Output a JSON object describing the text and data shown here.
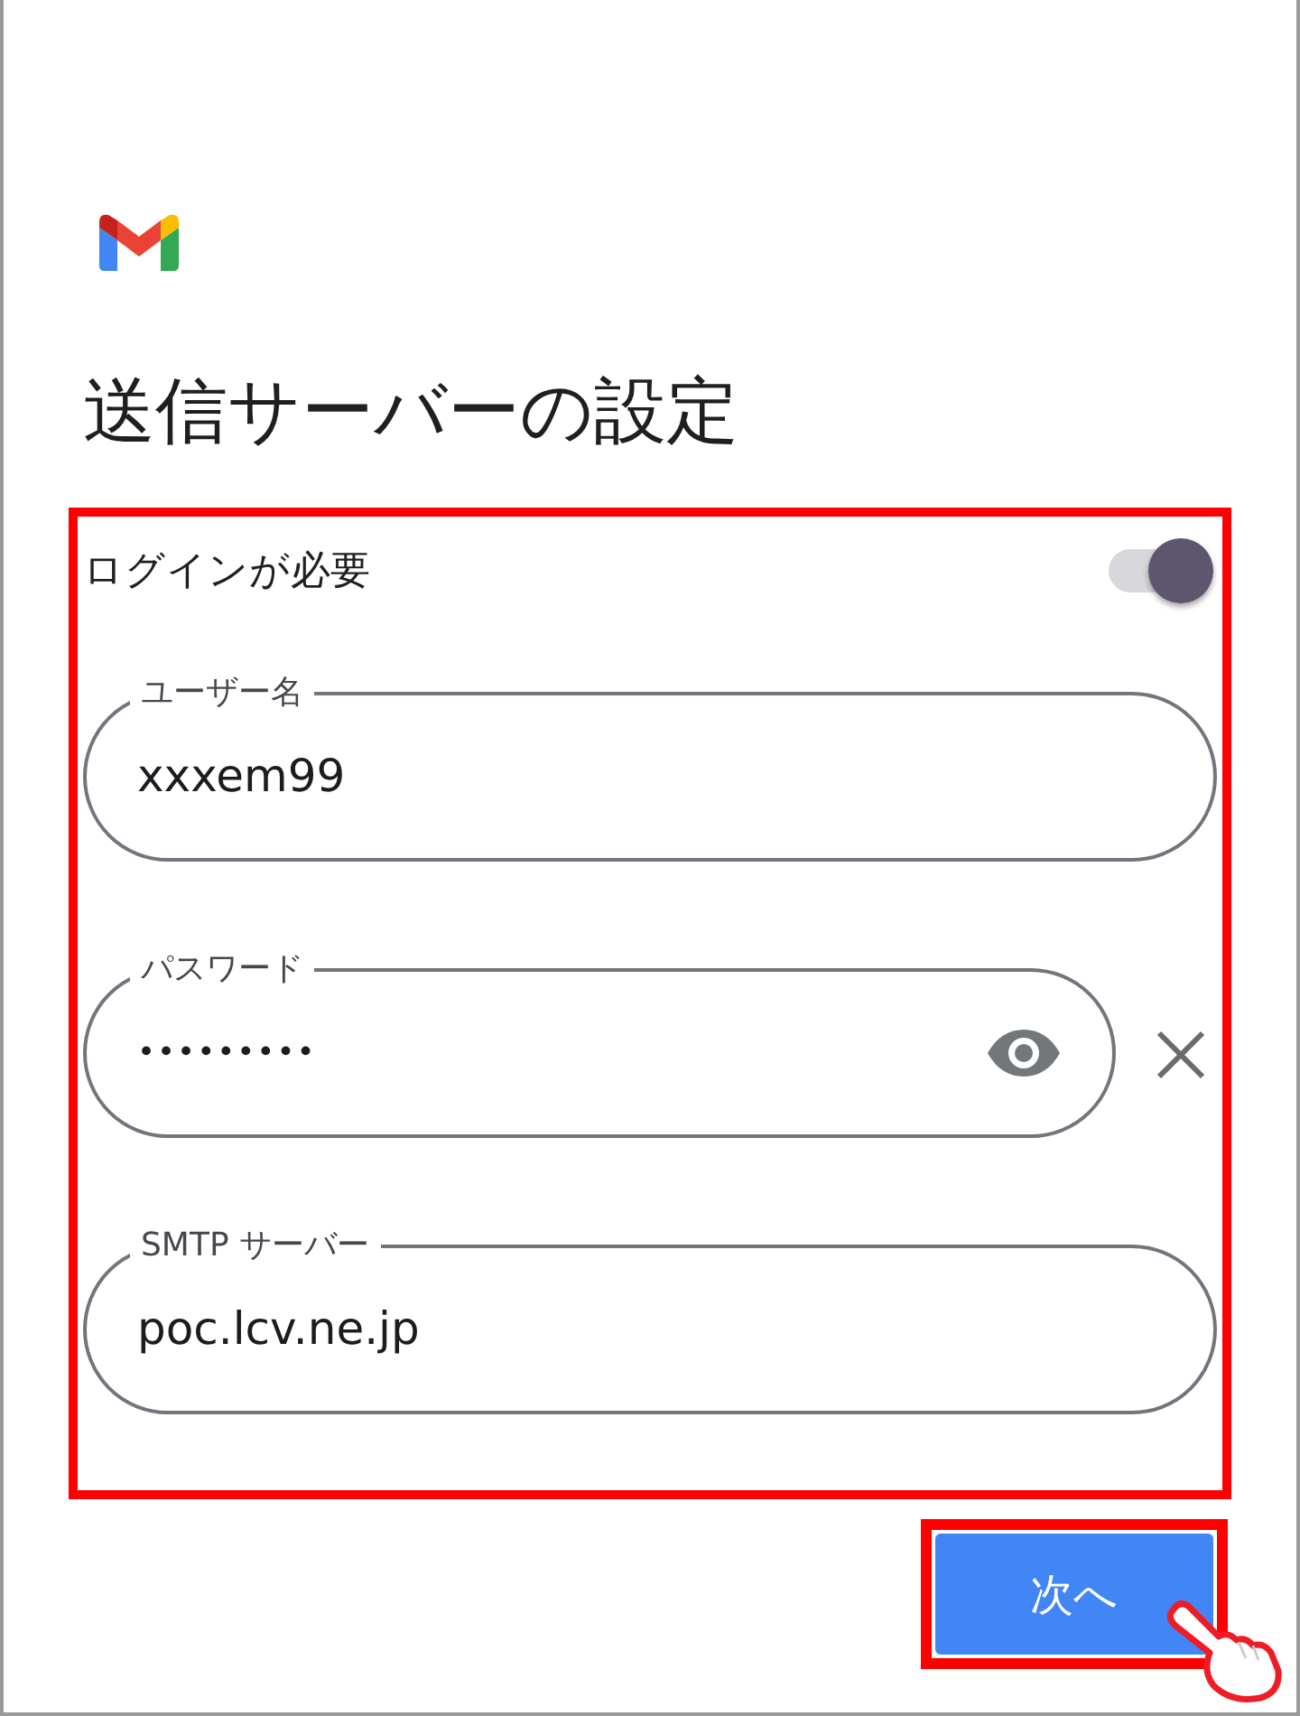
{
  "title": "送信サーバーの設定",
  "login_required": {
    "label": "ログインが必要",
    "on": true
  },
  "section": {
    "highlight": true
  },
  "fields": [
    {
      "kind": "text",
      "label": "ユーザー名",
      "value": "xxxem99"
    },
    {
      "kind": "password",
      "label": "パスワード",
      "value": "•••••••••"
    },
    {
      "kind": "text",
      "label": "SMTP サーバー",
      "value": "poc.lcv.ne.jp"
    }
  ],
  "next_button": {
    "label": "次へ",
    "highlight": true
  }
}
